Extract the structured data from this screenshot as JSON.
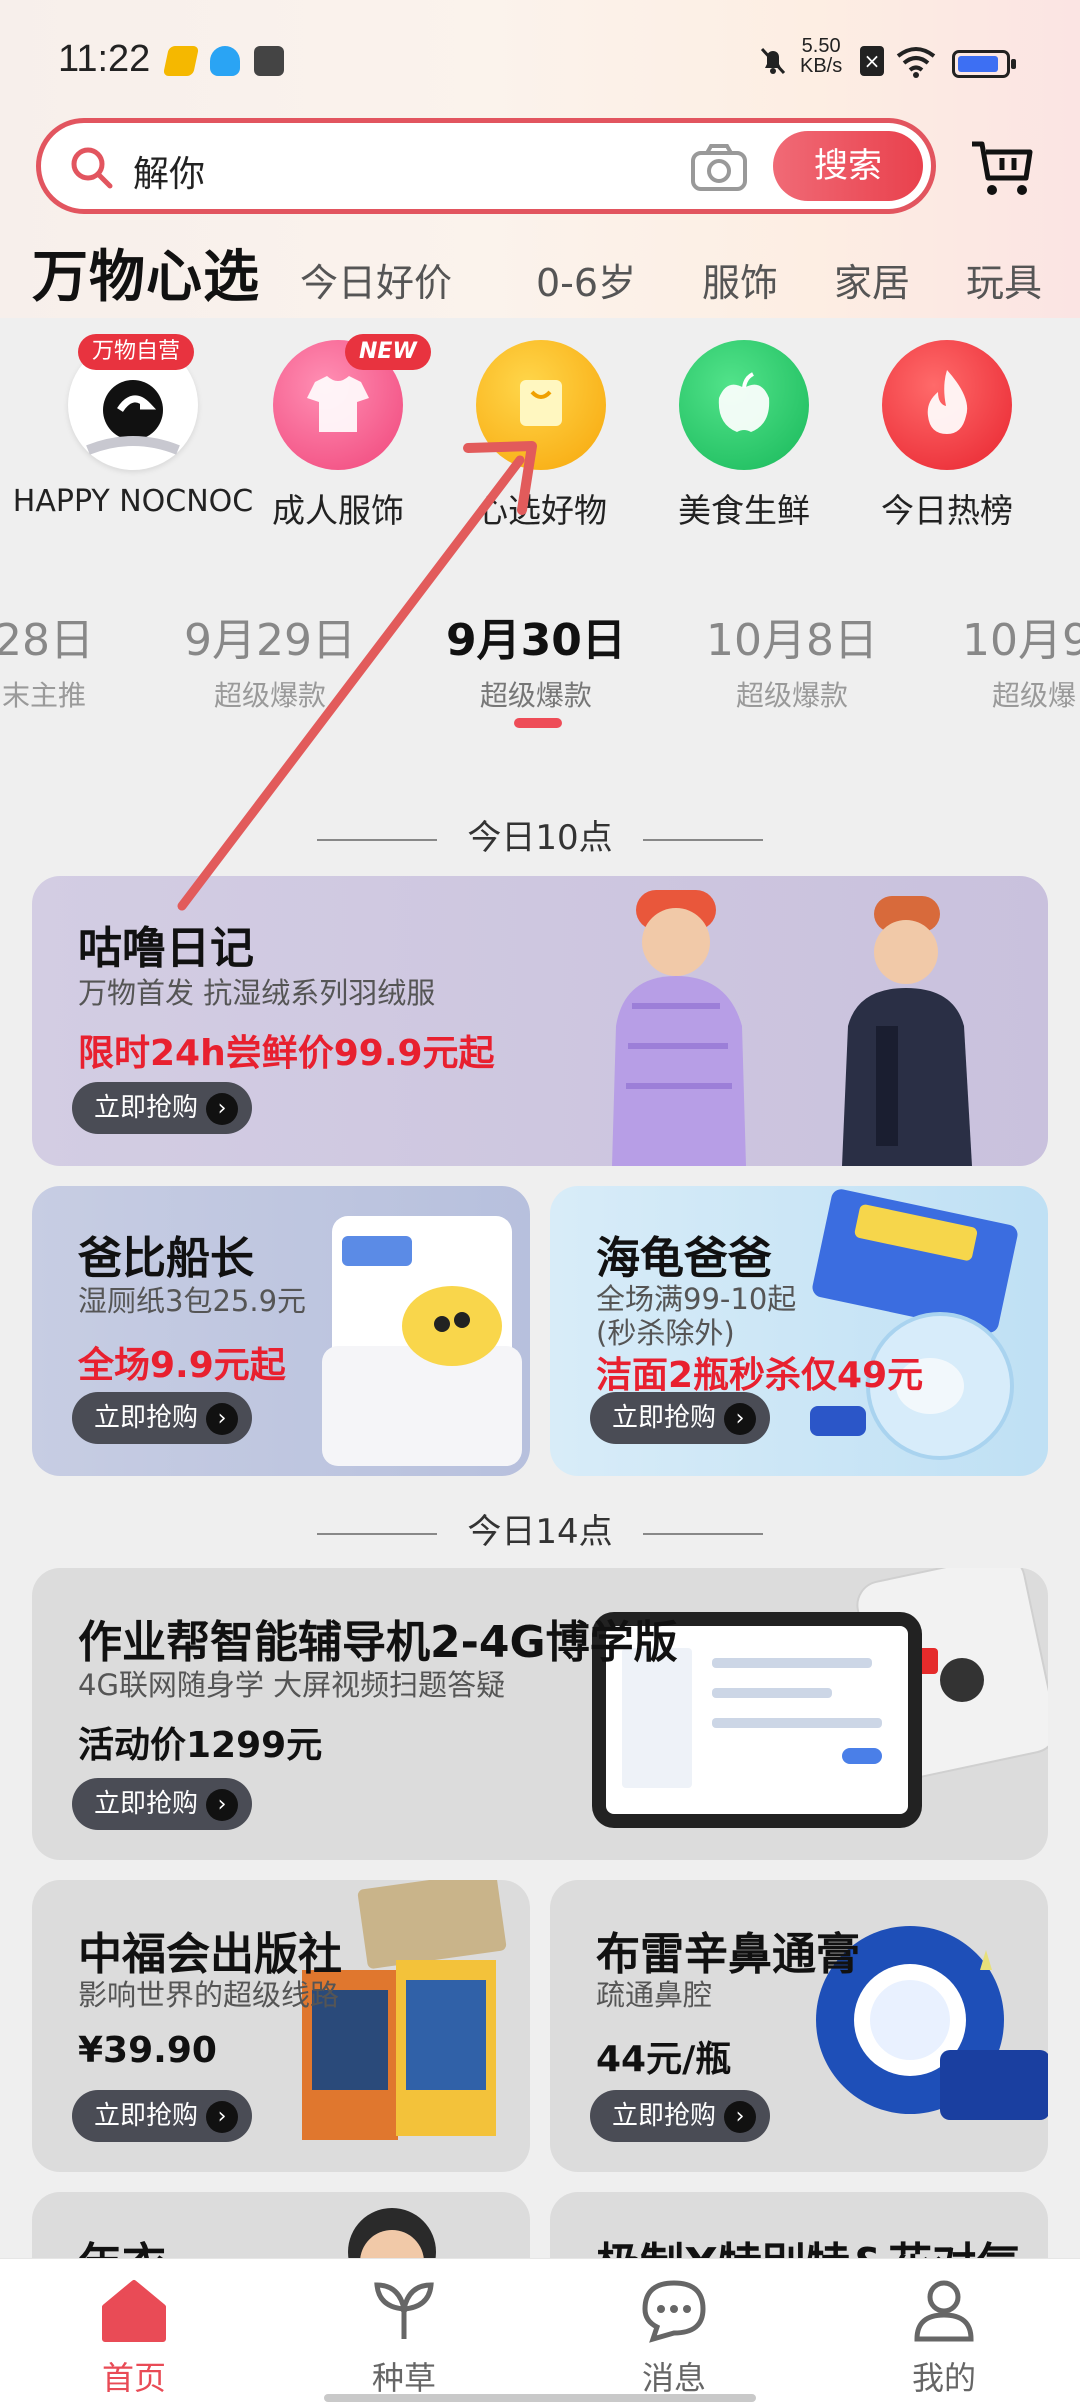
{
  "status_bar": {
    "time": "11:22",
    "net_speed_value": "5.50",
    "net_speed_unit": "KB/s"
  },
  "search": {
    "query": "解你",
    "button_label": "搜索"
  },
  "brand": "万物心选",
  "tabs": [
    "今日好价",
    "0-6岁",
    "服饰",
    "家居",
    "玩具"
  ],
  "categories": [
    {
      "label": "HAPPY NOCNOC",
      "badge": "万物自营"
    },
    {
      "label": "成人服饰",
      "badge": "NEW"
    },
    {
      "label": "心选好物",
      "badge": ""
    },
    {
      "label": "美食生鲜",
      "badge": ""
    },
    {
      "label": "今日热榜",
      "badge": ""
    }
  ],
  "dates": [
    {
      "date": "28日",
      "sub": "末主推"
    },
    {
      "date": "9月29日",
      "sub": "超级爆款"
    },
    {
      "date": "9月30日",
      "sub": "超级爆款",
      "active": true
    },
    {
      "date": "10月8日",
      "sub": "超级爆款"
    },
    {
      "date": "10月9",
      "sub": "超级爆"
    }
  ],
  "sections": [
    {
      "title": "今日10点"
    },
    {
      "title": "今日14点"
    }
  ],
  "cards": {
    "gulu": {
      "title": "咕噜日记",
      "subtitle": "万物首发 抗湿绒系列羽绒服",
      "price": "限时24h尝鲜价99.9元起",
      "cta": "立即抢购"
    },
    "babi": {
      "title": "爸比船长",
      "subtitle": "湿厕纸3包25.9元",
      "price": "全场9.9元起",
      "cta": "立即抢购"
    },
    "haigui": {
      "title": "海龟爸爸",
      "subtitle": "全场满99-10起",
      "subtitle2": "(秒杀除外)",
      "price": "洁面2瓶秒杀仅49元",
      "cta": "立即抢购"
    },
    "zuoyebang": {
      "title": "作业帮智能辅导机2-4G博学版",
      "subtitle": "4G联网随身学 大屏视频扫题答疑",
      "price": "活动价1299元",
      "cta": "立即抢购"
    },
    "zhongfu": {
      "title": "中福会出版社",
      "subtitle": "影响世界的超级线路",
      "price": "¥39.90",
      "cta": "立即抢购"
    },
    "bulei": {
      "title": "布雷辛鼻通膏",
      "subtitle": "疏通鼻腔",
      "price": "44元/瓶",
      "cta": "立即抢购"
    },
    "partial_left": {
      "title": "年衣"
    },
    "partial_right": {
      "title": "极制X特别特&花对气"
    }
  },
  "bottom_nav": [
    {
      "label": "首页",
      "active": true
    },
    {
      "label": "种草"
    },
    {
      "label": "消息"
    },
    {
      "label": "我的"
    }
  ],
  "colors": {
    "accent": "#e94b56",
    "search_border": "#e2555f",
    "promo_red": "#e8202f",
    "annotation_arrow": "#e25b5b"
  }
}
